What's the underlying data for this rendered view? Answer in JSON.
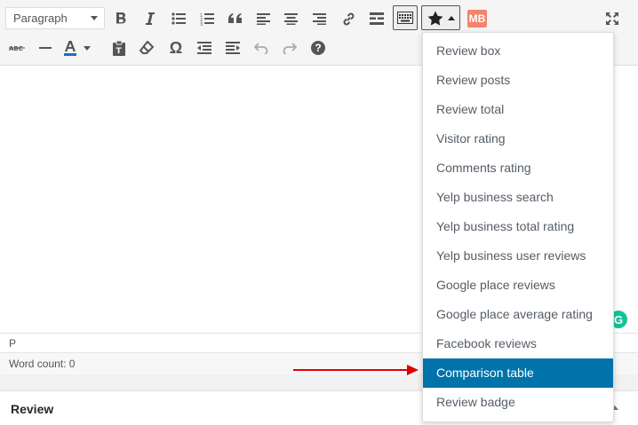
{
  "toolbar": {
    "format_select": "Paragraph",
    "mb_logo": "MB",
    "special_char": "Ω",
    "help": "?"
  },
  "editor": {
    "path": "P",
    "word_count": "Word count: 0"
  },
  "dropdown": {
    "items": [
      "Review box",
      "Review posts",
      "Review total",
      "Visitor rating",
      "Comments rating",
      "Yelp business search",
      "Yelp business total rating",
      "Yelp business user reviews",
      "Google place reviews",
      "Google place average rating",
      "Facebook reviews",
      "Comparison table",
      "Review badge"
    ],
    "active_index": 11
  },
  "metabox": {
    "title": "Review"
  },
  "colors": {
    "accent": "#0073aa",
    "arrow": "#e00000",
    "grammarly": "#15c39a",
    "mb_logo": "#f4846b"
  }
}
